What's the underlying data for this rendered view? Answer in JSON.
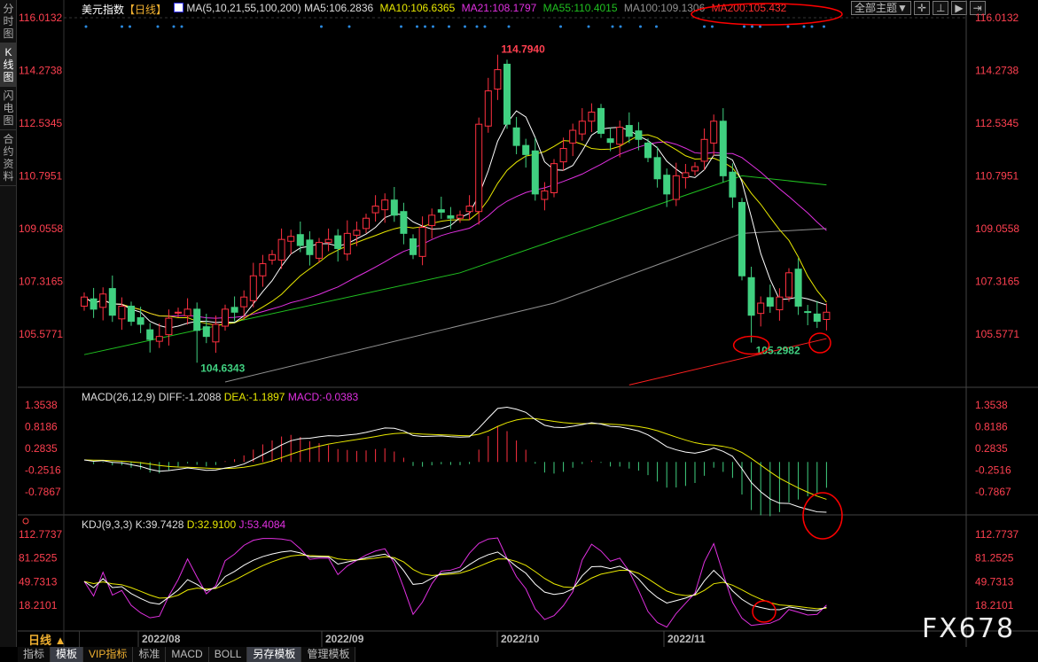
{
  "sidebar_tabs": [
    "分时图",
    "K线图",
    "闪电图",
    "合约资料"
  ],
  "header": {
    "title": "美元指数",
    "period": "【日线】",
    "ma_label": "MA(5,10,21,55,100,200)",
    "ma5": "MA5:106.2836",
    "ma10": "MA10:106.6365",
    "ma21": "MA21:108.1797",
    "ma55": "MA55:110.4015",
    "ma100": "MA100:109.1306",
    "ma200": "MA200:105.432",
    "theme_button": "全部主题▼"
  },
  "colors": {
    "up": "#ff3040",
    "down": "#40d080",
    "ma5": "#ffffff",
    "ma10": "#e8e800",
    "ma21": "#e030e0",
    "ma55": "#20c020",
    "ma100": "#909090",
    "ma200": "#ff2020"
  },
  "price_axis": [
    "116.0132",
    "114.2738",
    "112.5345",
    "110.7951",
    "109.0558",
    "107.3165",
    "105.5771"
  ],
  "annotations": {
    "high": "114.7940",
    "low1": "104.6343",
    "low2": "105.2982"
  },
  "macd": {
    "label": "MACD(26,12,9)",
    "diff": "DIFF:-1.2088",
    "dea": "DEA:-1.1897",
    "macd": "MACD:-0.0383",
    "axis": [
      "1.3538",
      "0.8186",
      "0.2835",
      "-0.2516",
      "-0.7867"
    ]
  },
  "kdj": {
    "label": "KDJ(9,3,3)",
    "k": "K:39.7428",
    "d": "D:32.9100",
    "j": "J:53.4084",
    "axis": [
      "112.7737",
      "81.2525",
      "49.7313",
      "18.2101"
    ]
  },
  "dates": [
    "2022/08",
    "2022/09",
    "2022/10",
    "2022/11"
  ],
  "period_label": "日线 ▲",
  "bottom_tabs": [
    "指标",
    "模板",
    "VIP指标",
    "标准",
    "MACD",
    "BOLL",
    "另存模板",
    "管理模板"
  ],
  "watermark": "FX678",
  "chart_data": {
    "type": "candlestick",
    "title": "美元指数 日线",
    "closes": [
      106.8,
      106.4,
      106.9,
      106.2,
      106.5,
      106.0,
      105.9,
      105.4,
      105.5,
      106.1,
      106.3,
      106.4,
      105.7,
      105.5,
      105.9,
      106.4,
      106.3,
      106.8,
      107.5,
      107.9,
      108.2,
      108.7,
      108.8,
      108.5,
      108.2,
      108.6,
      108.7,
      108.4,
      108.9,
      109.0,
      109.4,
      109.8,
      110.0,
      109.5,
      108.9,
      108.2,
      109.1,
      109.5,
      109.6,
      109.4,
      109.5,
      109.8,
      112.5,
      113.6,
      114.3,
      112.5,
      111.8,
      111.5,
      110.2,
      110.3,
      111.2,
      111.7,
      112.3,
      112.6,
      112.9,
      112.2,
      111.9,
      112.4,
      112.1,
      112.0,
      111.4,
      110.7,
      110.2,
      110.8,
      110.9,
      111.1,
      112.0,
      112.6,
      110.8,
      110.1,
      107.5,
      106.2,
      106.6,
      106.5,
      106.8,
      107.6,
      106.5,
      106.3,
      106.0,
      106.3
    ],
    "high_index": 44,
    "low_index": 12,
    "low2_index": 71,
    "ma55": [
      [
        0,
        104.9
      ],
      [
        40,
        107.6
      ],
      [
        70,
        110.8
      ],
      [
        79,
        110.5
      ]
    ],
    "ma100": [
      [
        15,
        104.0
      ],
      [
        50,
        106.6
      ],
      [
        70,
        108.9
      ],
      [
        79,
        109.06
      ]
    ],
    "ma200": [
      [
        58,
        103.9
      ],
      [
        79,
        105.43
      ]
    ],
    "ylim": [
      103.9,
      116.0132
    ]
  }
}
